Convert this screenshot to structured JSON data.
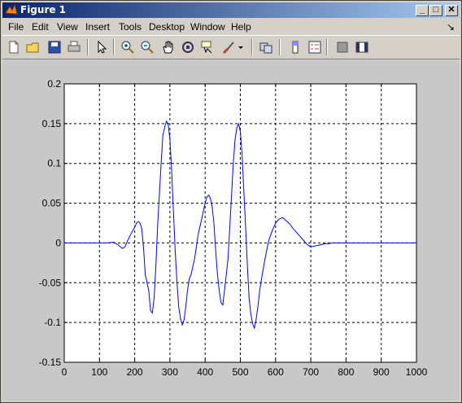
{
  "window": {
    "title": "Figure 1"
  },
  "title_buttons": {
    "minimize": "_",
    "maximize": "□",
    "close": "✕"
  },
  "menu": {
    "items": [
      "File",
      "Edit",
      "View",
      "Insert",
      "Tools",
      "Desktop",
      "Window",
      "Help"
    ],
    "dock_arrow": "↘"
  },
  "toolbar": {
    "tools": [
      "new-figure-icon",
      "open-file-icon",
      "save-icon",
      "print-icon",
      "edit-plot-arrow-icon",
      "zoom-in-icon",
      "zoom-out-icon",
      "pan-hand-icon",
      "rotate-3d-icon",
      "data-cursor-icon",
      "brush-icon",
      "link-plot-icon",
      "colorbar-icon",
      "legend-icon",
      "hide-plot-tools-icon",
      "show-plot-tools-icon"
    ]
  },
  "colors": {
    "line": "#0000ff",
    "titlebar_start": "#0a246a",
    "titlebar_end": "#a6caf0",
    "figure_bg": "#c8c8c8"
  },
  "chart_data": {
    "type": "line",
    "title": "",
    "xlabel": "",
    "ylabel": "",
    "xlim": [
      0,
      1000
    ],
    "ylim": [
      -0.15,
      0.2
    ],
    "xticks": [
      0,
      100,
      200,
      300,
      400,
      500,
      600,
      700,
      800,
      900,
      1000
    ],
    "yticks": [
      -0.15,
      -0.1,
      -0.05,
      0,
      0.05,
      0.1,
      0.15,
      0.2
    ],
    "xtick_labels": [
      "0",
      "100",
      "200",
      "300",
      "400",
      "500",
      "600",
      "700",
      "800",
      "900",
      "1000"
    ],
    "ytick_labels": [
      "-0.15",
      "-0.1",
      "-0.05",
      "0",
      "0.05",
      "0.1",
      "0.15",
      "0.2"
    ],
    "grid": true,
    "series": [
      {
        "x": [
          0,
          120,
          140,
          155,
          165,
          172,
          180,
          190,
          200,
          205,
          210,
          215,
          220,
          225,
          230,
          235,
          240,
          245,
          250,
          255,
          260,
          265,
          270,
          275,
          280,
          285,
          290,
          295,
          300,
          305,
          310,
          315,
          320,
          325,
          330,
          335,
          340,
          345,
          350,
          355,
          360,
          365,
          370,
          375,
          380,
          385,
          390,
          395,
          400,
          405,
          410,
          415,
          420,
          425,
          430,
          435,
          440,
          445,
          450,
          455,
          460,
          465,
          470,
          475,
          480,
          485,
          490,
          495,
          500,
          505,
          510,
          515,
          520,
          525,
          530,
          535,
          540,
          545,
          550,
          555,
          560,
          570,
          580,
          590,
          600,
          610,
          620,
          630,
          640,
          650,
          660,
          670,
          680,
          690,
          700,
          710,
          720,
          730,
          740,
          750,
          760,
          780,
          800,
          1000
        ],
        "y": [
          0,
          0,
          0.001,
          -0.003,
          -0.007,
          -0.005,
          0.003,
          0.012,
          0.02,
          0.025,
          0.027,
          0.025,
          0.018,
          -0.005,
          -0.04,
          -0.05,
          -0.06,
          -0.085,
          -0.088,
          -0.07,
          -0.03,
          0.02,
          0.06,
          0.1,
          0.135,
          0.145,
          0.153,
          0.15,
          0.13,
          0.09,
          0.04,
          -0.01,
          -0.05,
          -0.08,
          -0.095,
          -0.103,
          -0.097,
          -0.08,
          -0.06,
          -0.045,
          -0.04,
          -0.03,
          -0.02,
          -0.005,
          0.01,
          0.02,
          0.03,
          0.04,
          0.05,
          0.058,
          0.06,
          0.056,
          0.045,
          0.025,
          -0.01,
          -0.04,
          -0.06,
          -0.075,
          -0.078,
          -0.06,
          -0.04,
          -0.02,
          0.02,
          0.06,
          0.1,
          0.13,
          0.145,
          0.15,
          0.14,
          0.11,
          0.065,
          0.02,
          -0.03,
          -0.07,
          -0.09,
          -0.102,
          -0.107,
          -0.095,
          -0.08,
          -0.06,
          -0.045,
          -0.02,
          0.002,
          0.015,
          0.025,
          0.03,
          0.032,
          0.028,
          0.024,
          0.018,
          0.013,
          0.008,
          0.003,
          -0.002,
          -0.005,
          -0.004,
          -0.003,
          -0.002,
          -0.001,
          -0.001,
          0,
          0,
          0,
          0
        ]
      }
    ]
  }
}
